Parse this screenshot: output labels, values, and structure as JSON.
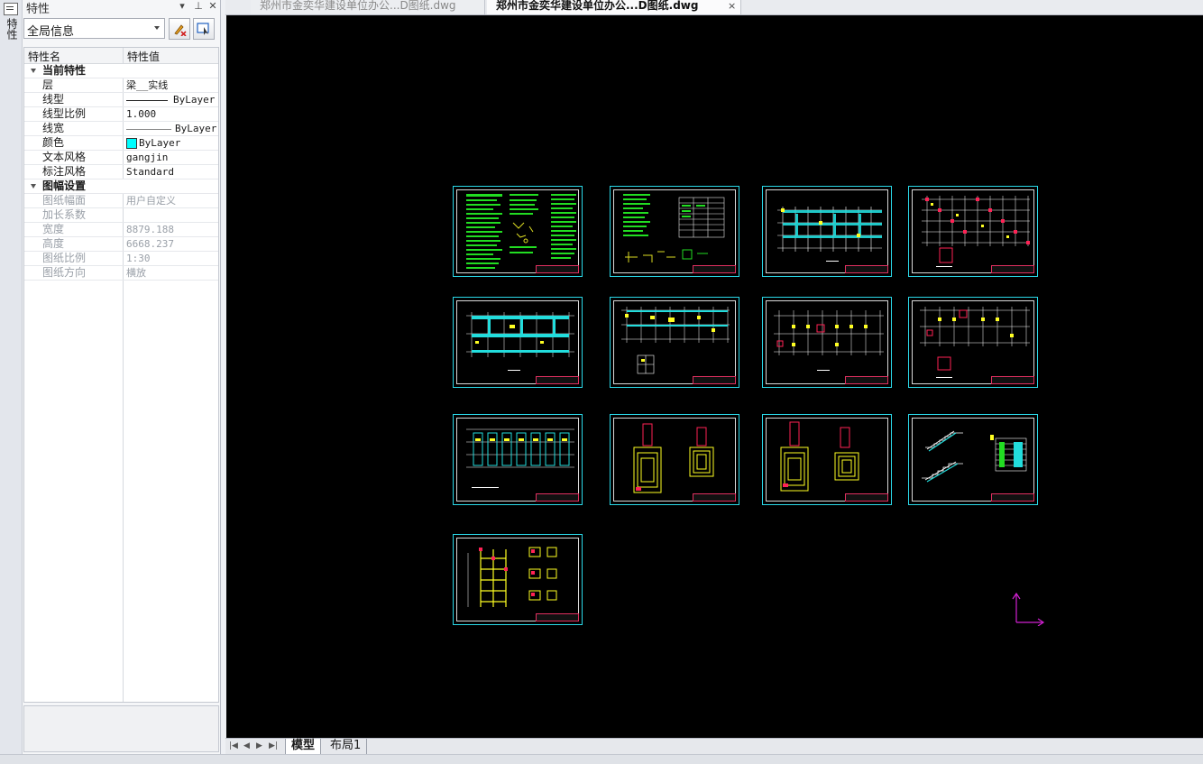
{
  "app": {
    "left_strip_tab": "特性"
  },
  "palette": {
    "title": "特性",
    "menu_icon": "triangle-down-icon",
    "pin_icon": "pin-icon",
    "close_icon": "close-icon",
    "selection": "全局信息",
    "col_name": "特性名",
    "col_value": "特性值",
    "groups": [
      {
        "title": "当前特性",
        "rows": [
          {
            "name": "层",
            "value": "梁__实线"
          },
          {
            "name": "线型",
            "value": "ByLayer"
          },
          {
            "name": "线型比例",
            "value": "1.000"
          },
          {
            "name": "线宽",
            "value": "ByLayer"
          },
          {
            "name": "颜色",
            "value": "ByLayer"
          },
          {
            "name": "文本风格",
            "value": "gangjin"
          },
          {
            "name": "标注风格",
            "value": "Standard"
          }
        ]
      },
      {
        "title": "图幅设置",
        "rows": [
          {
            "name": "图纸幅面",
            "value": "用户自定义"
          },
          {
            "name": "加长系数",
            "value": ""
          },
          {
            "name": "宽度",
            "value": "8879.188"
          },
          {
            "name": "高度",
            "value": "6668.237"
          },
          {
            "name": "图纸比例",
            "value": "1:30"
          },
          {
            "name": "图纸方向",
            "value": "横放"
          }
        ]
      }
    ],
    "color_swatch": "#00ffff"
  },
  "tabs": {
    "doc1": "郑州市金奕华建设单位办公...D图纸.dwg",
    "doc2": "郑州市金奕华建设单位办公...D图纸.dwg",
    "close": "×"
  },
  "layout": {
    "model": "模型",
    "layout1": "布局1"
  },
  "colors": {
    "canvas_bg": "#000000",
    "frame": "#2ad8e8",
    "ucs": "#d020d0"
  }
}
